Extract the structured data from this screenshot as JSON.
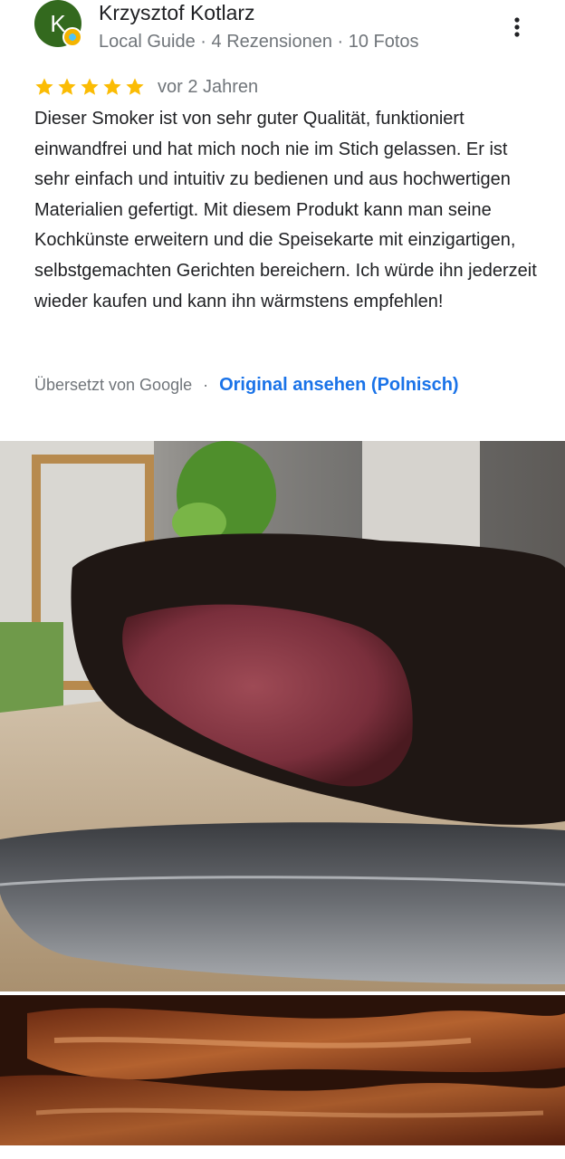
{
  "review": {
    "author": {
      "initial": "K",
      "name": "Krzysztof Kotlarz",
      "meta": "Local Guide · 4 Rezensionen · 10 Fotos",
      "avatar_color": "#33691e"
    },
    "rating": {
      "value": 5,
      "max": 5,
      "star_color": "#fbbc04"
    },
    "date": "vor 2 Jahren",
    "text": "Dieser Smoker ist von sehr guter Qualität, funktioniert einwandfrei und hat mich noch nie im Stich gelassen. Er ist sehr einfach und intuitiv zu bedienen und aus hochwertigen Materialien gefertigt. Mit diesem Produkt kann man seine Kochkünste erweitern und die Speisekarte mit einzigartigen, selbstgemachten Gerichten bereichern. Ich würde ihn jederzeit wieder kaufen und kann ihn wärmstens empfehlen!",
    "translated_by": "Übersetzt von Google",
    "separator": "·",
    "original_link": "Original ansehen (Polnisch)",
    "link_color": "#1a73e8",
    "photos": [
      {
        "icon": "smoked-meat-photo"
      },
      {
        "icon": "smoked-bacon-photo"
      }
    ]
  }
}
